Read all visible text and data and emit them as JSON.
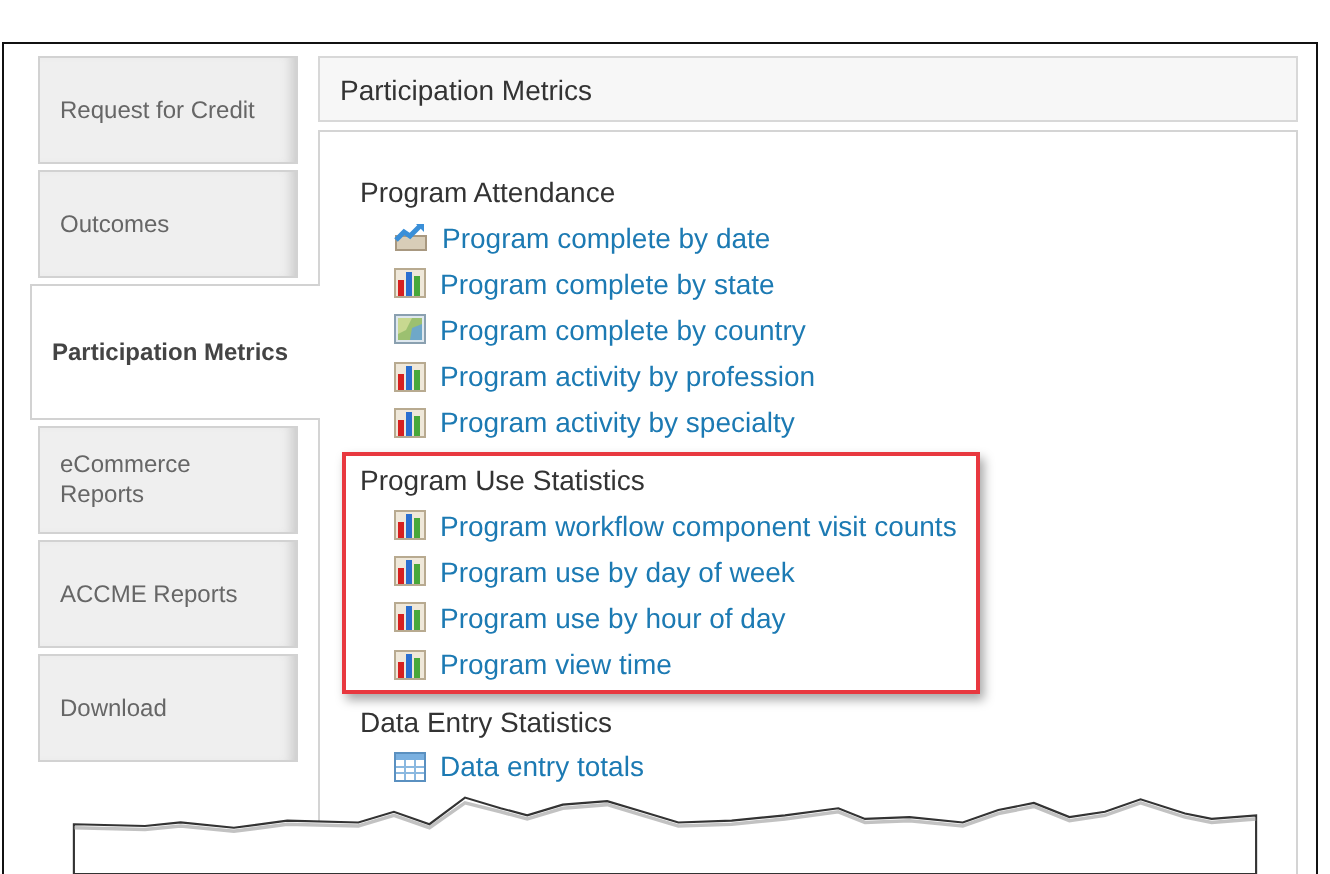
{
  "nav_tabs": [
    {
      "label": "Request for Credit",
      "selected": false
    },
    {
      "label": "Outcomes",
      "selected": false
    },
    {
      "label": "Participation Metrics",
      "selected": true
    },
    {
      "label": "eCommerce Reports",
      "selected": false
    },
    {
      "label": "ACCME Reports",
      "selected": false
    },
    {
      "label": "Download",
      "selected": false
    }
  ],
  "panel": {
    "title": "Participation Metrics"
  },
  "sections": [
    {
      "heading": "Program Attendance",
      "highlighted": false,
      "links": [
        {
          "label": "Program complete by date",
          "kind": "line"
        },
        {
          "label": "Program complete by state",
          "kind": "bar"
        },
        {
          "label": "Program complete by country",
          "kind": "map"
        },
        {
          "label": "Program activity by profession",
          "kind": "bar"
        },
        {
          "label": "Program activity by specialty",
          "kind": "bar"
        }
      ]
    },
    {
      "heading": "Program Use Statistics",
      "highlighted": true,
      "links": [
        {
          "label": "Program workflow component visit counts",
          "kind": "bar"
        },
        {
          "label": "Program use by day of week",
          "kind": "bar"
        },
        {
          "label": "Program use by hour of day",
          "kind": "bar"
        },
        {
          "label": "Program view time",
          "kind": "bar"
        }
      ]
    },
    {
      "heading": "Data Entry Statistics",
      "highlighted": false,
      "links": [
        {
          "label": "Data entry totals",
          "kind": "table"
        }
      ]
    }
  ]
}
